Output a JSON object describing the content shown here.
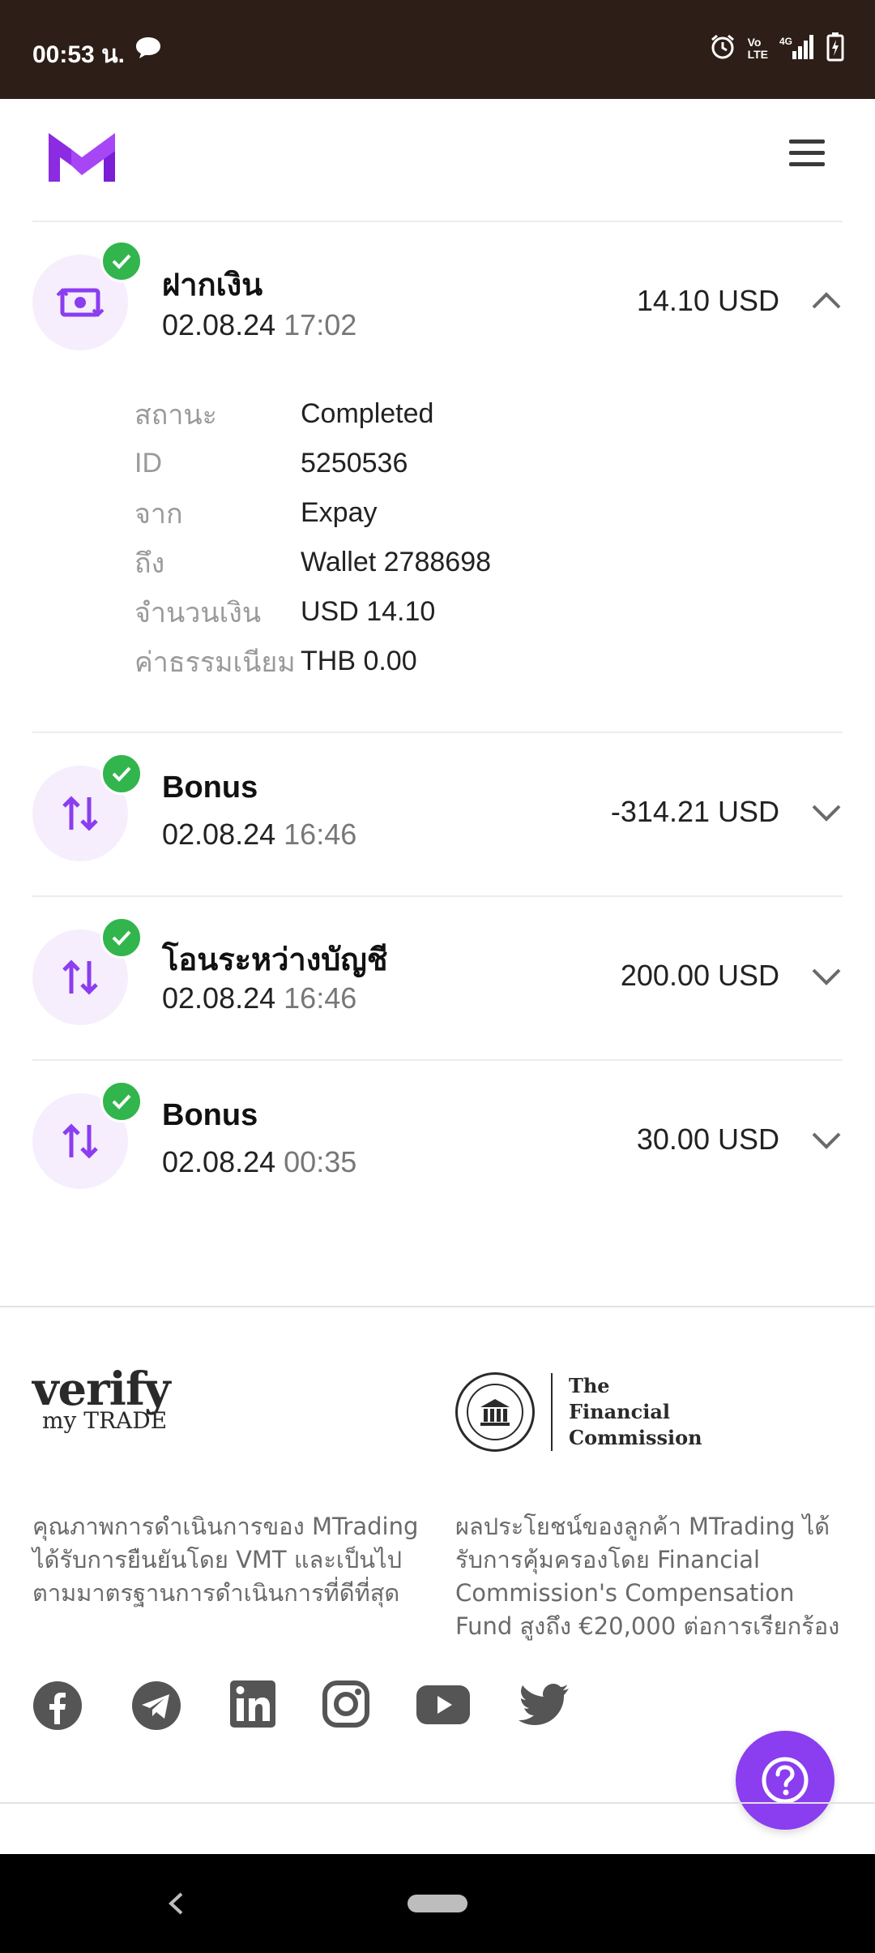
{
  "status_bar": {
    "time": "00:53 น.",
    "network": "4G"
  },
  "transactions": [
    {
      "title": "ฝากเงิน",
      "date": "02.08.24",
      "time": "17:02",
      "amount": "14.10 USD",
      "expanded": true,
      "details": [
        {
          "label": "สถานะ",
          "value": "Completed"
        },
        {
          "label": "ID",
          "value": "5250536"
        },
        {
          "label": "จาก",
          "value": "Expay"
        },
        {
          "label": "ถึง",
          "value": "Wallet 2788698"
        },
        {
          "label": "จำนวนเงิน",
          "value": "USD 14.10"
        },
        {
          "label": "ค่าธรรมเนียม",
          "value": "THB 0.00"
        }
      ]
    },
    {
      "title": "Bonus",
      "date": "02.08.24",
      "time": "16:46",
      "amount": "-314.21 USD",
      "expanded": false
    },
    {
      "title": "โอนระหว่างบัญชี",
      "date": "02.08.24",
      "time": "16:46",
      "amount": "200.00 USD",
      "expanded": false
    },
    {
      "title": "Bonus",
      "date": "02.08.24",
      "time": "00:35",
      "amount": "30.00 USD",
      "expanded": false
    }
  ],
  "footer": {
    "verify_logo": {
      "line1": "verify",
      "line2": "my TRADE"
    },
    "fc_logo": {
      "line1": "The",
      "line2": "Financial",
      "line3": "Commission"
    },
    "verify_text": "คุณภาพการดำเนินการของ MTrading ได้รับการยืนยันโดย VMT และเป็นไปตามมาตรฐานการดำเนินการที่ดีที่สุด",
    "fc_text": "ผลประโยชน์ของลูกค้า MTrading ได้รับการคุ้มครองโดย Financial Commission's Compensation Fund สูงถึง €20,000 ต่อการเรียกร้อง",
    "social": [
      "facebook-icon",
      "telegram-icon",
      "linkedin-icon",
      "instagram-icon",
      "youtube-icon",
      "twitter-icon"
    ]
  },
  "colors": {
    "accent": "#8b3df0",
    "success": "#32b54d",
    "statusbar": "#2d1e17"
  }
}
